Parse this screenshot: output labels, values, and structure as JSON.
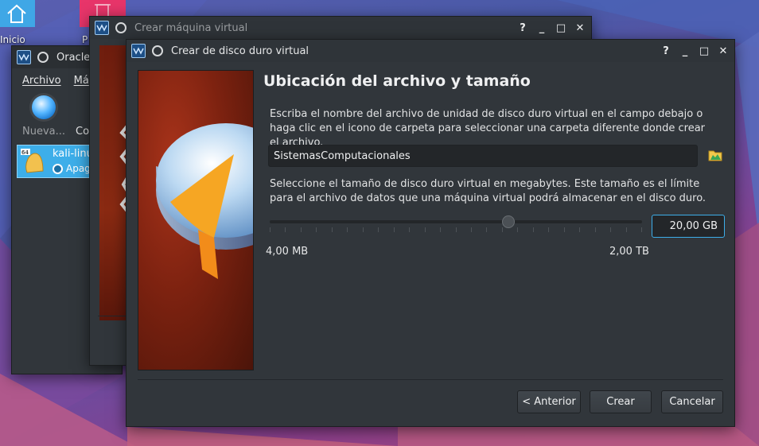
{
  "desktop": {
    "home_label": "Inicio",
    "trash_label": "P"
  },
  "oracle_window": {
    "title": "Oracle",
    "menu": [
      {
        "label": "Archivo"
      },
      {
        "label": "Má"
      }
    ],
    "new_label": "Nueva...",
    "co_label": "Co",
    "vm": {
      "name": "kali-linu",
      "state": "Apag",
      "badge": "64"
    }
  },
  "machine_window": {
    "title": "Crear máquina virtual"
  },
  "disk_dialog": {
    "title": "Crear de disco duro virtual",
    "heading": "Ubicación del archivo y tamaño",
    "description_location": "Escriba el nombre del archivo de unidad de disco duro virtual en el campo debajo o haga clic en el icono de carpeta para seleccionar una carpeta diferente donde crear el archivo.",
    "file_name": "SistemasComputacionales",
    "description_size": "Seleccione el tamaño de disco duro virtual en megabytes. Este tamaño es el límite para el archivo de datos que una máquina virtual podrá almacenar en el disco duro.",
    "size_value": "20,00 GB",
    "slider_fraction": 0.64,
    "range_min": "4,00 MB",
    "range_max": "2,00 TB",
    "buttons": {
      "back_prefix": "< ",
      "back_label": "Anterior",
      "create_label": "Crear",
      "cancel_label": "Cancelar"
    }
  },
  "window_buttons": {
    "help": "?",
    "minimize": "_",
    "maximize": "□",
    "close": "✕"
  },
  "colors": {
    "accent": "#3daee9",
    "window_bg": "#31363b",
    "field_bg": "#232629"
  }
}
